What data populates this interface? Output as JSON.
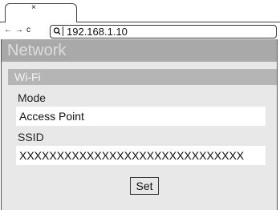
{
  "browser": {
    "tab_close": "×",
    "back": "←",
    "forward": "→",
    "reload": "c",
    "url": "192.168.1.10"
  },
  "page": {
    "title": "Network",
    "section_title": "Wi-Fi",
    "fields": [
      {
        "label": "Mode",
        "value": "Access Point"
      },
      {
        "label": "SSID",
        "value": "XXXXXXXXXXXXXXXXXXXXXXXXXXXXXX"
      }
    ],
    "set_label": "Set"
  }
}
